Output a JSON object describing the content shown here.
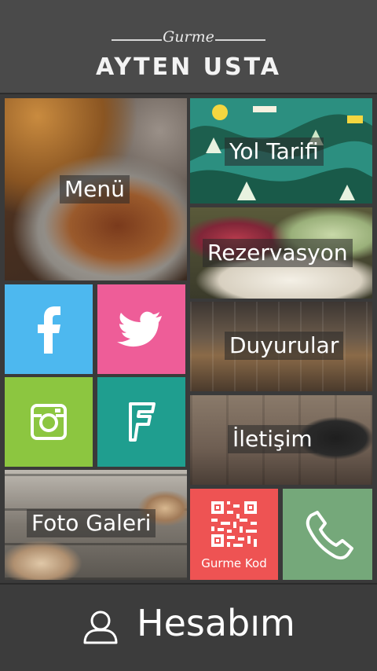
{
  "header": {
    "subtitle": "Gurme",
    "title": "AYTEN USTA"
  },
  "tiles": {
    "menu": "Menü",
    "yol_tarifi": "Yol Tarifi",
    "rezervasyon": "Rezervasyon",
    "duyurular": "Duyurular",
    "iletisim": "İletişim",
    "foto_galeri": "Foto Galeri",
    "gurme_kod": "Gurme Kod"
  },
  "footer": {
    "label": "Hesabım"
  },
  "icons": {
    "facebook": "facebook-icon",
    "twitter": "twitter-icon",
    "instagram": "instagram-icon",
    "foursquare": "foursquare-icon",
    "qr": "qr-code-icon",
    "phone": "phone-icon",
    "user": "user-icon"
  },
  "colors": {
    "facebook": "#4db8ef",
    "twitter": "#ee5d98",
    "instagram": "#8cc640",
    "foursquare": "#1f9e8f",
    "gurme_kod": "#ee5353",
    "phone": "#75a87a"
  }
}
